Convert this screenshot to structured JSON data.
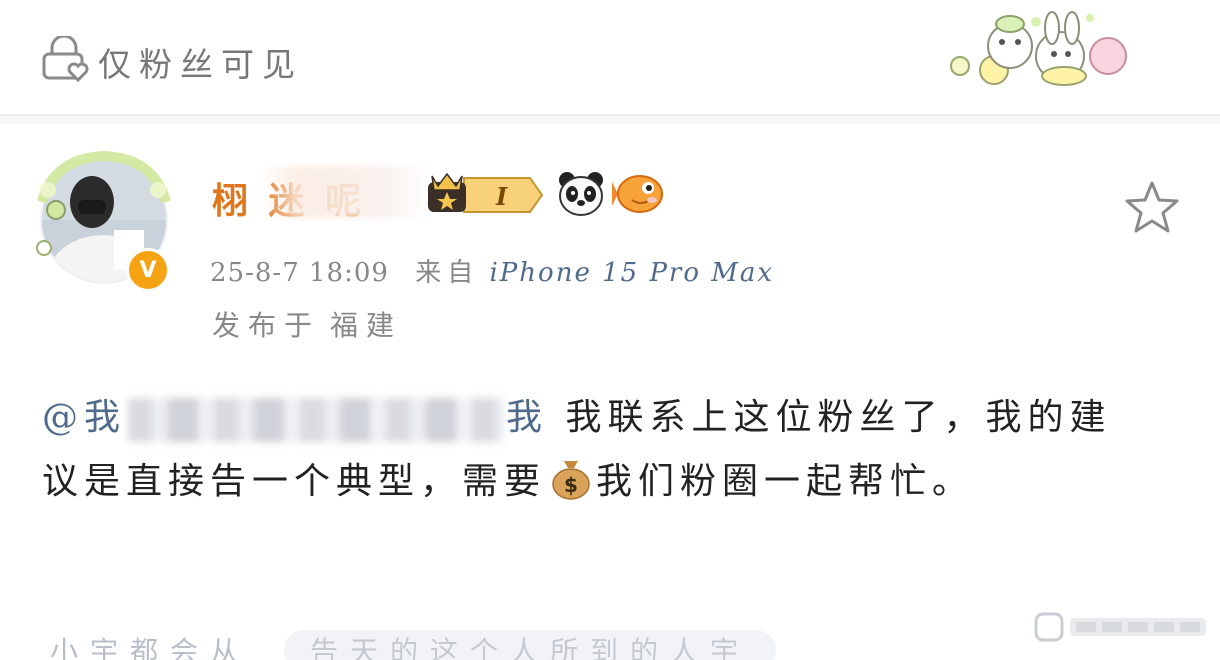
{
  "header": {
    "visibility_label": "仅粉丝可见",
    "sticker": "bunny-bear-flowers-sticker"
  },
  "post": {
    "username_visible": "栩 迷 呢",
    "badges": [
      "crown-level-badge",
      "panda-icon",
      "fish-icon"
    ],
    "level_letter": "I",
    "timestamp": "25-8-7 18:09",
    "source_prefix": "来自",
    "device": "iPhone 15 Pro Max",
    "location_prefix": "发布于",
    "location": "福建",
    "mention_start": "@我",
    "mention_end": "我",
    "text_1": "我联系上这位粉丝了，我的建议是直接告一个典型，需要",
    "money_emoji": "💰",
    "text_2": "我们粉圈一起帮忙。"
  },
  "footer": {
    "faded_left": "小宇都会从",
    "faded_pill": "告天的这个人所到的人宇"
  },
  "colors": {
    "username": "#e0771d",
    "link": "#506a8c",
    "vbadge": "#f6a313"
  }
}
